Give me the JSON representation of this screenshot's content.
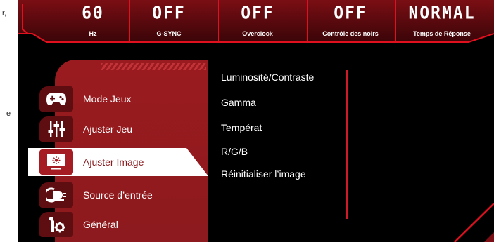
{
  "stray_text": [
    "r,",
    "e"
  ],
  "status": [
    {
      "value": "60",
      "label": "Hz"
    },
    {
      "value": "OFF",
      "label": "G-SYNC"
    },
    {
      "value": "OFF",
      "label": "Overclock"
    },
    {
      "value": "OFF",
      "label": "Contrôle des noirs"
    },
    {
      "value": "NORMAL",
      "label": "Temps de Réponse"
    }
  ],
  "menu": {
    "items": [
      {
        "label": "Mode Jeux",
        "icon": "gamepad-icon"
      },
      {
        "label": "Ajuster Jeu",
        "icon": "sliders-icon"
      },
      {
        "label": "Ajuster Image",
        "icon": "monitor-brightness-icon",
        "active": true
      },
      {
        "label": "Source d’entrée",
        "icon": "input-source-icon"
      },
      {
        "label": "Général",
        "icon": "wrench-gear-icon"
      }
    ]
  },
  "submenu": {
    "items": [
      {
        "label": "Luminosité/Contraste"
      },
      {
        "label": "Gamma"
      },
      {
        "label": "Températ"
      },
      {
        "label": "R/G/B"
      },
      {
        "label": "Réinitialiser l’image"
      }
    ]
  },
  "colors": {
    "accent": "#e0101e",
    "panel": "#8c1a1e",
    "icon_box": "#5e0d11",
    "background": "#000000"
  }
}
